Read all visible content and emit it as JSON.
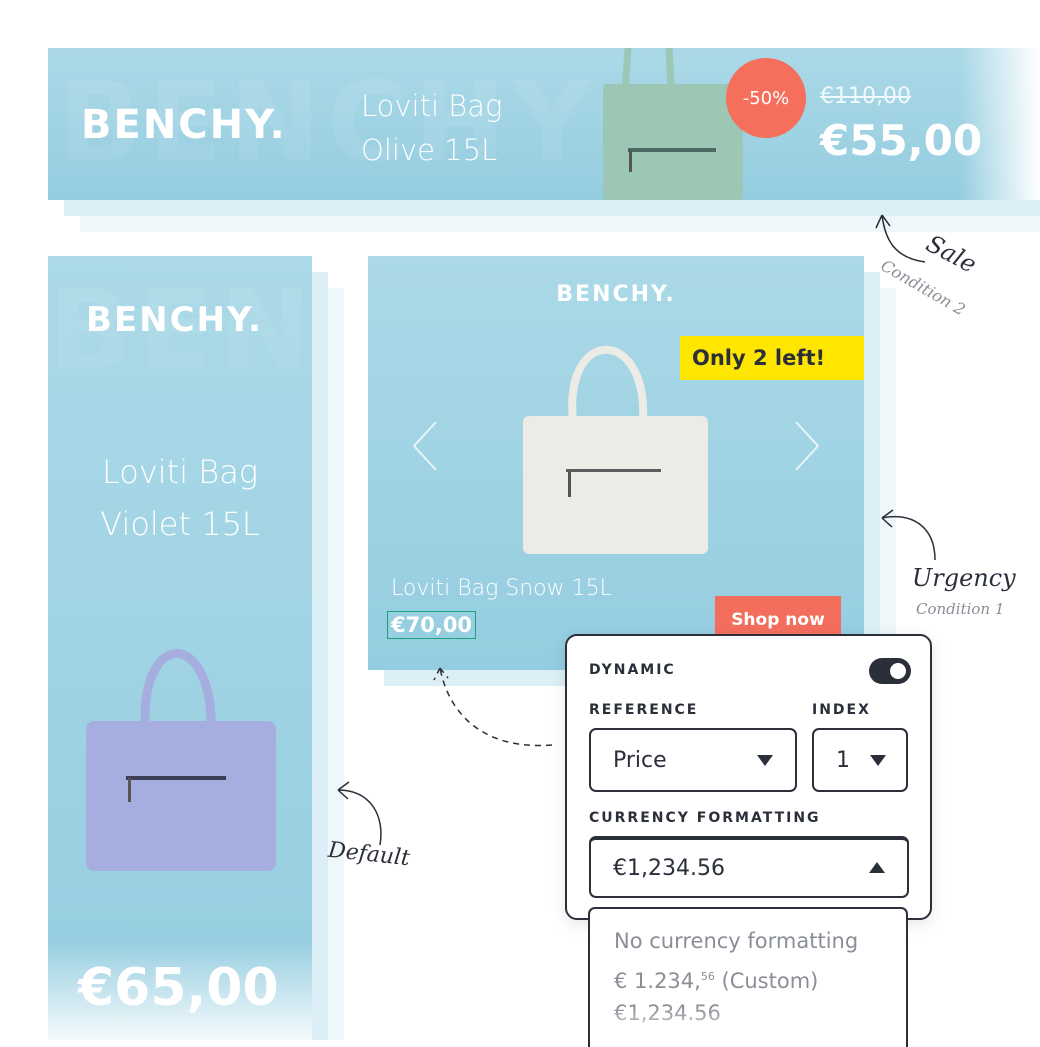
{
  "sale_banner": {
    "logo": "BENCHY.",
    "title_line1": "Loviti Bag",
    "title_line2": "Olive 15L",
    "discount": "-50%",
    "old_price": "€110,00",
    "price": "€55,00",
    "bag_color": "#9cc7b5"
  },
  "default_banner": {
    "logo": "BENCHY.",
    "title_line1": "Loviti Bag",
    "title_line2": "Violet 15L",
    "price": "€65,00",
    "bag_color": "#a6aee0"
  },
  "urgency_banner": {
    "logo": "BENCHY.",
    "badge": "Only 2 left!",
    "title": "Loviti Bag Snow 15L",
    "price": "€70,00",
    "cta": "Shop now",
    "bag_color": "#ecebe5"
  },
  "annotations": {
    "sale": "Sale",
    "sale_condition": "Condition 2",
    "urgency": "Urgency",
    "urgency_condition": "Condition 1",
    "default": "Default"
  },
  "panel": {
    "dynamic_label": "DYNAMIC",
    "dynamic_on": true,
    "reference_label": "REFERENCE",
    "reference_value": "Price",
    "index_label": "INDEX",
    "index_value": "1",
    "currency_label": "CURRENCY FORMATTING",
    "currency_value": "€1,234.56",
    "options": [
      {
        "main": "No currency formatting"
      },
      {
        "main": "€ 1.234,",
        "sup": "56",
        "suffix": " (Custom)"
      },
      {
        "main": "€1,234.56"
      }
    ]
  },
  "colors": {
    "banner_bg": "#a9d8e6",
    "sale_badge": "#f66e5c",
    "urgency_badge": "#ffe600",
    "cta": "#f46e5e",
    "dark": "#2a2f3a",
    "selection": "#1aa37a"
  }
}
